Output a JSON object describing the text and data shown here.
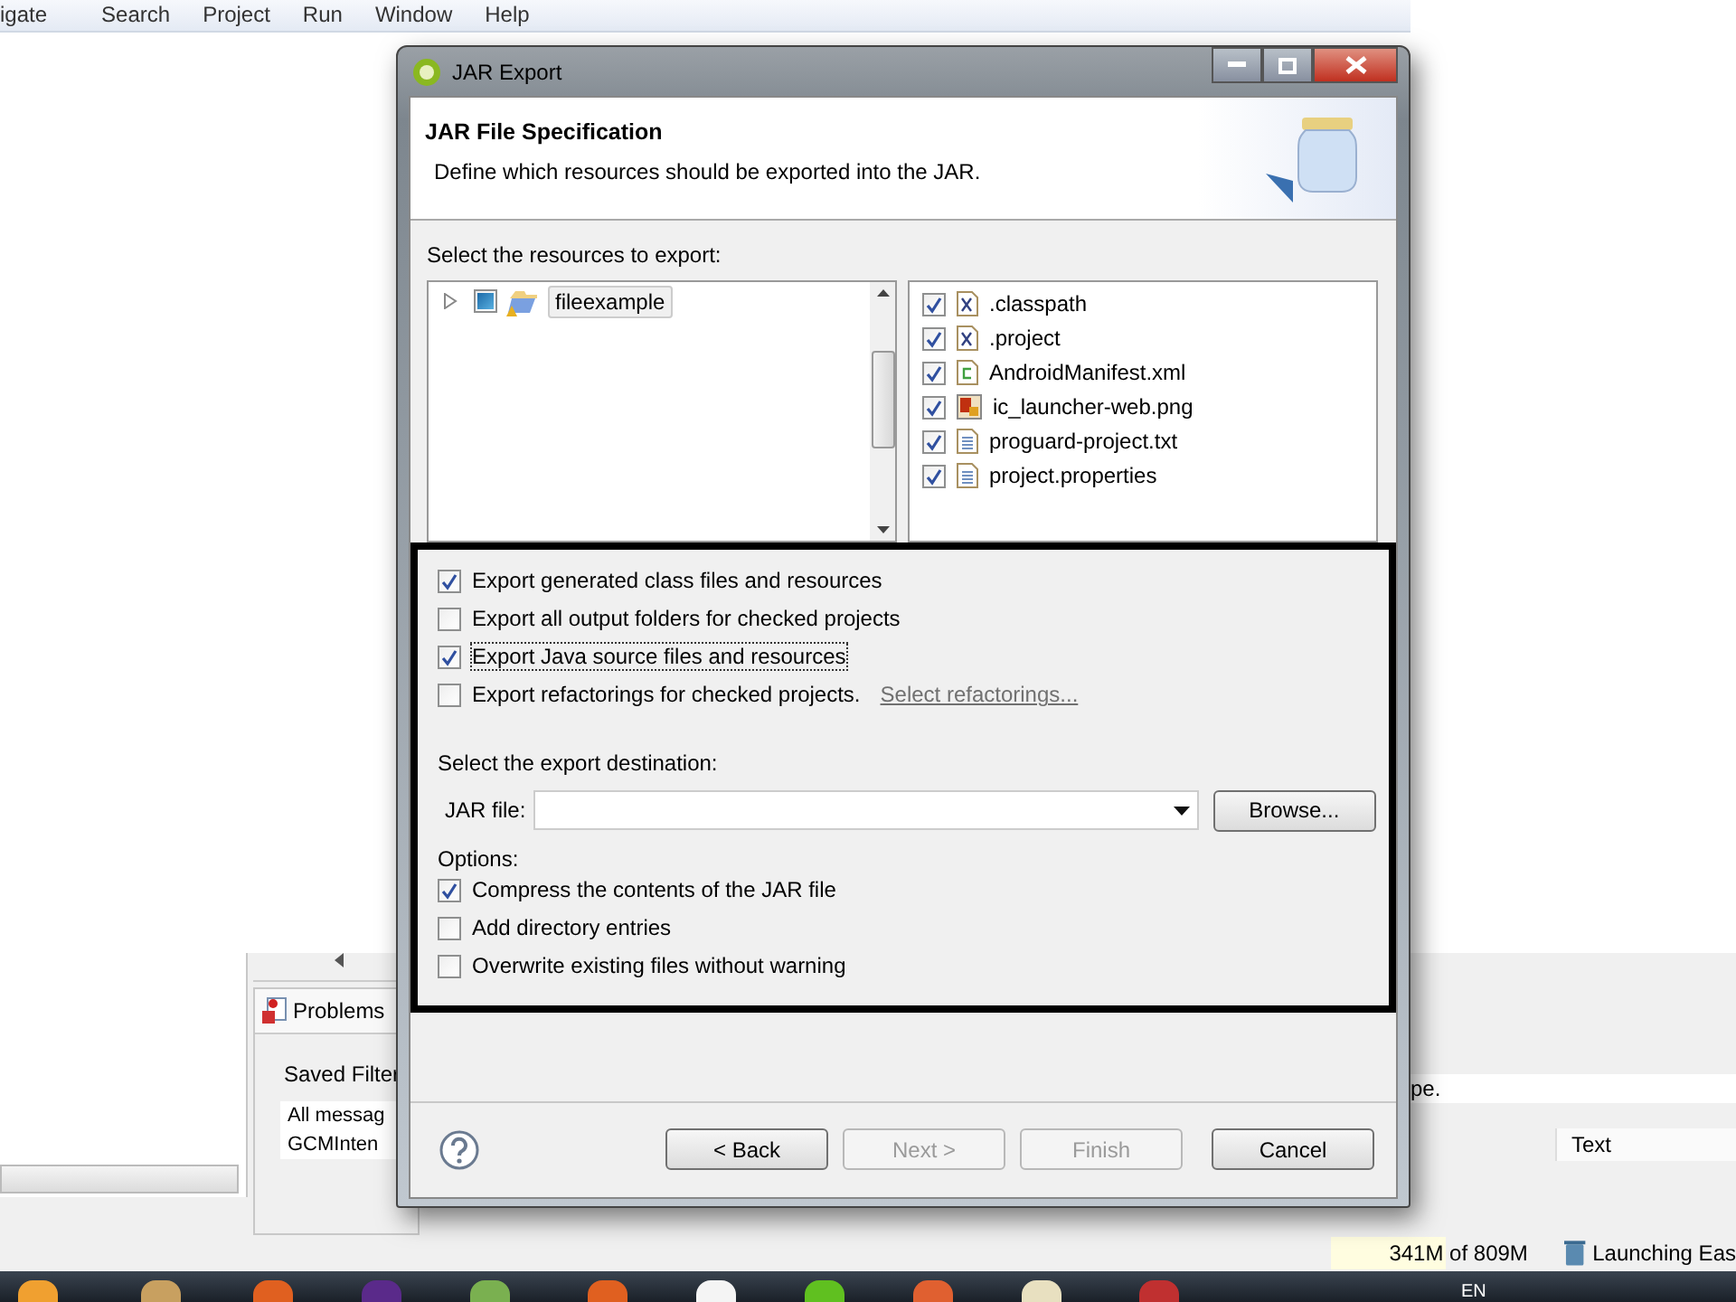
{
  "menu": [
    "igate",
    "Search",
    "Project",
    "Run",
    "Window",
    "Help"
  ],
  "ide": {
    "problems_tab": "Problems",
    "saved_filters": "Saved Filter",
    "filters": [
      "All messag",
      "GCMInten"
    ],
    "message_tail": "pe.",
    "column": "Text",
    "memory": "341M of 809M",
    "status": "Launching Eas",
    "language": "EN"
  },
  "dialog": {
    "title": "JAR Export",
    "heading": "JAR File Specification",
    "description": "Define which resources should be exported into the JAR.",
    "resources_label": "Select the resources to export:",
    "tree": [
      {
        "label": "fileexample",
        "partial": true,
        "expanded": false,
        "selected": true
      }
    ],
    "files": [
      {
        "name": ".classpath",
        "checked": true,
        "kind": "xml"
      },
      {
        "name": ".project",
        "checked": true,
        "kind": "xml"
      },
      {
        "name": "AndroidManifest.xml",
        "checked": true,
        "kind": "manifest"
      },
      {
        "name": "ic_launcher-web.png",
        "checked": true,
        "kind": "image"
      },
      {
        "name": "proguard-project.txt",
        "checked": true,
        "kind": "text"
      },
      {
        "name": "project.properties",
        "checked": true,
        "kind": "text"
      }
    ],
    "export_options": [
      {
        "label": "Export generated class files and resources",
        "checked": true,
        "focused": false
      },
      {
        "label": "Export all output folders for checked projects",
        "checked": false,
        "focused": false
      },
      {
        "label": "Export Java source files and resources",
        "checked": true,
        "focused": true
      },
      {
        "label": "Export refactorings for checked projects.",
        "checked": false,
        "focused": false,
        "link": "Select refactorings..."
      }
    ],
    "destination_label": "Select the export destination:",
    "jar_file_label": "JAR file:",
    "browse": "Browse...",
    "options_label": "Options:",
    "options": [
      {
        "label": "Compress the contents of the JAR file",
        "checked": true
      },
      {
        "label": "Add directory entries",
        "checked": false
      },
      {
        "label": "Overwrite existing files without warning",
        "checked": false
      }
    ],
    "buttons": [
      {
        "label": "< Back",
        "disabled": false
      },
      {
        "label": "Next >",
        "disabled": true
      },
      {
        "label": "Finish",
        "disabled": true
      },
      {
        "label": "Cancel",
        "disabled": false
      }
    ]
  }
}
